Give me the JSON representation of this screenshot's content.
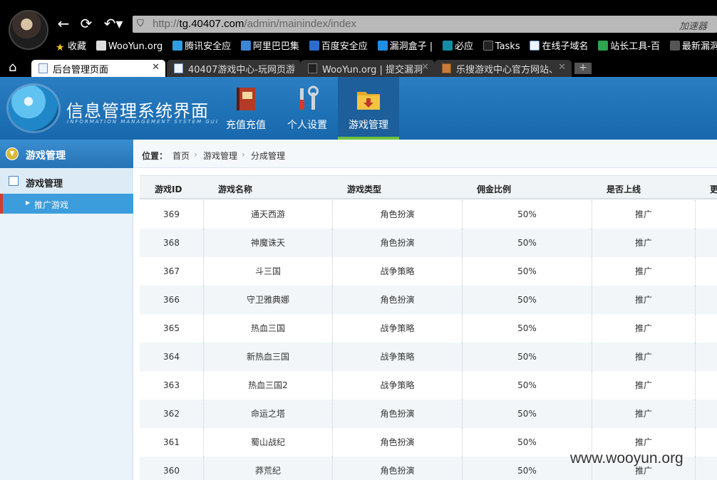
{
  "browser": {
    "url_host": "tg.40407.com",
    "url_path": "/admin/mainindex/index",
    "url_prefix": "http://",
    "accelerator": "加速器",
    "bookmarks": [
      "收藏",
      "WooYun.org",
      "腾讯安全应",
      "阿里巴巴集",
      "百度安全应",
      "漏洞盒子 |",
      "必应",
      "Tasks",
      "在线子域名",
      "站长工具-百",
      "最新漏洞 -"
    ],
    "tabs": [
      {
        "label": "后台管理页面",
        "active": true
      },
      {
        "label": "40407游戏中心-玩网页游",
        "active": false
      },
      {
        "label": "WooYun.org | 提交漏洞",
        "active": false
      },
      {
        "label": "乐搜游戏中心官方网站、",
        "active": false
      }
    ]
  },
  "header": {
    "title": "信息管理系统界面",
    "subtitle": "INFORMATION MANAGEMENT SYSTEM GUI",
    "nav": [
      {
        "label": "充值充值",
        "icon": "book-icon"
      },
      {
        "label": "个人设置",
        "icon": "tools-icon"
      },
      {
        "label": "游戏管理",
        "icon": "folder-icon",
        "active": true
      }
    ]
  },
  "sidebar": {
    "section": "游戏管理",
    "group": "游戏管理",
    "active_item": "推广游戏"
  },
  "breadcrumb": {
    "label": "位置：",
    "items": [
      "首页",
      "游戏管理",
      "分成管理"
    ],
    "sep": "›"
  },
  "table": {
    "columns": [
      "游戏ID",
      "游戏名称",
      "游戏类型",
      "佣金比例",
      "是否上线",
      "更"
    ],
    "rows": [
      {
        "id": "369",
        "name": "通天西游",
        "type": "角色扮演",
        "ratio": "50%",
        "online": "推广"
      },
      {
        "id": "368",
        "name": "神魔诛天",
        "type": "角色扮演",
        "ratio": "50%",
        "online": "推广"
      },
      {
        "id": "367",
        "name": "斗三国",
        "type": "战争策略",
        "ratio": "50%",
        "online": "推广"
      },
      {
        "id": "366",
        "name": "守卫雅典娜",
        "type": "角色扮演",
        "ratio": "50%",
        "online": "推广"
      },
      {
        "id": "365",
        "name": "热血三国",
        "type": "战争策略",
        "ratio": "50%",
        "online": "推广"
      },
      {
        "id": "364",
        "name": "新热血三国",
        "type": "战争策略",
        "ratio": "50%",
        "online": "推广"
      },
      {
        "id": "363",
        "name": "热血三国2",
        "type": "战争策略",
        "ratio": "50%",
        "online": "推广"
      },
      {
        "id": "362",
        "name": "命运之塔",
        "type": "角色扮演",
        "ratio": "50%",
        "online": "推广"
      },
      {
        "id": "361",
        "name": "蜀山战纪",
        "type": "角色扮演",
        "ratio": "50%",
        "online": "推广"
      },
      {
        "id": "360",
        "name": "莽荒纪",
        "type": "角色扮演",
        "ratio": "50%",
        "online": "推广"
      }
    ]
  },
  "watermark": "www.wooyun.org",
  "colors": {
    "header_blue": "#1768ad",
    "active_green": "#6cc440",
    "sidebar_active": "#3c9ddc"
  }
}
